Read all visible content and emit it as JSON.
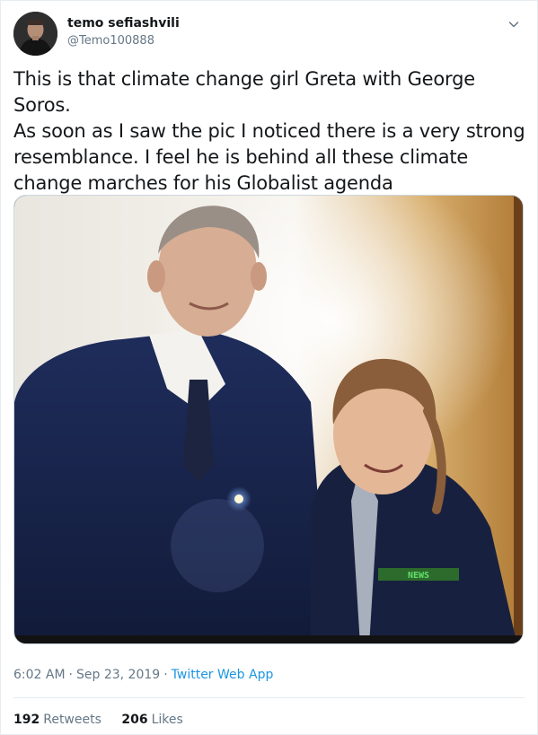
{
  "tweet": {
    "author": {
      "display_name": "temo sefiashvili",
      "handle": "@Temo100888"
    },
    "text": "This is that climate change girl Greta with George Soros.\nAs soon as I saw the pic I noticed there is a very strong\nresemblance. I feel he is behind all these climate\nchange marches for his Globalist agenda",
    "photo": {
      "jacket_label": "NEWS"
    },
    "time": "6:02 AM",
    "separator": "·",
    "date": "Sep 23, 2019",
    "source_separator": "·",
    "source": "Twitter Web App",
    "retweets": {
      "count": "192",
      "label": "Retweets"
    },
    "likes": {
      "count": "206",
      "label": "Likes"
    }
  },
  "colors": {
    "link": "#1b95e0",
    "secondary_text": "#657786",
    "primary_text": "#14171a",
    "border": "#e6ecf0"
  },
  "icons": {
    "caret": "chevron-down-icon"
  }
}
